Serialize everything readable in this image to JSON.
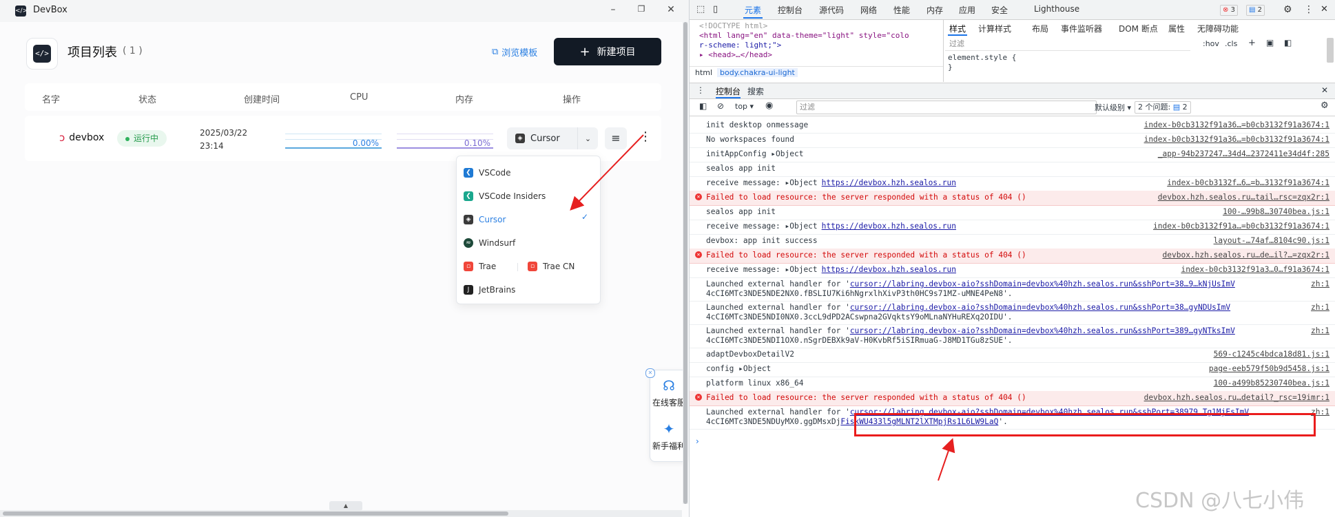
{
  "app": {
    "window_title": "DevBox",
    "logo_glyph": "</>",
    "page_title": "项目列表",
    "count": "( 1 )",
    "browse_label": "浏览模板",
    "new_button_label": "新建项目",
    "columns": [
      "名字",
      "状态",
      "创建时间",
      "CPU",
      "内存",
      "操作"
    ],
    "project": {
      "name": "devbox",
      "status": "运行中",
      "created_date": "2025/03/22",
      "created_time": "23:14",
      "cpu": "0.00%",
      "memory": "0.10%",
      "ide_selected": "Cursor",
      "cpu_fraction": 0.0,
      "memory_fraction": 0.001
    },
    "ide_menu": {
      "items": [
        "VSCode",
        "VSCode Insiders",
        "Cursor",
        "Windsurf",
        "Trae",
        "Trae CN",
        "JetBrains"
      ],
      "selected": "Cursor",
      "check": "✓"
    },
    "float_panel": {
      "support": "在线客服",
      "welfare": "新手福利"
    },
    "icons": [
      "box-icon",
      "plus-icon",
      "template-icon",
      "chevron-down-icon",
      "list-icon",
      "more-vertical-icon",
      "check-icon",
      "headset-icon",
      "sparkle-icon",
      "close-icon"
    ]
  },
  "devtools": {
    "tabs": [
      "元素",
      "控制台",
      "源代码",
      "网络",
      "性能",
      "内存",
      "应用",
      "安全",
      "Lighthouse"
    ],
    "active_tab": "元素",
    "error_count": "3",
    "message_count": "2",
    "elements_lines": [
      "<!DOCTYPE html>",
      "<html lang=\"en\" data-theme=\"light\" style=\"colo",
      "r-scheme: light;\">",
      "▸ <head>…</head>"
    ],
    "breadcrumbs": [
      "html",
      "body.chakra-ui-light"
    ],
    "styles_tabs": [
      "样式",
      "计算样式",
      "布局",
      "事件监听器",
      "DOM 断点",
      "属性",
      "无障碍功能"
    ],
    "styles_filter_placeholder": "过滤",
    "styles_hov": ":hov",
    "styles_cls": ".cls",
    "element_style_1": "element.style {",
    "element_style_2": "}",
    "console_tabs": [
      "控制台",
      "搜索"
    ],
    "context": "top ▾",
    "console_filter_placeholder": "过滤",
    "default_levels": "默认级别 ▾",
    "issues_label": "2 个问题:",
    "issues_count": "2",
    "logs": [
      {
        "type": "log",
        "msg": "init desktop onmessage",
        "src": "index-b0cb3132f91a36…=b0cb3132f91a3674:1"
      },
      {
        "type": "log",
        "msg": "No workspaces found",
        "src": "index-b0cb3132f91a36…=b0cb3132f91a3674:1"
      },
      {
        "type": "log",
        "msg": "initAppConfig ▸Object",
        "src": "_app-94b237247…34d4…2372411e34d4f:285"
      },
      {
        "type": "log",
        "msg": "sealos app init",
        "src": ""
      },
      {
        "type": "log",
        "msg": "receive message: ▸Object",
        "link": "https://devbox.hzh.sealos.run",
        "src": "index-b0cb3132f…6…=b…3132f91a3674:1"
      },
      {
        "type": "error",
        "msg": "Failed to load resource: the server responded with a status of 404 ()",
        "src": "devbox.hzh.sealos.ru…tail…rsc=zqx2r:1"
      },
      {
        "type": "log",
        "msg": "sealos app init",
        "src": "100-…99b8…30740bea.js:1"
      },
      {
        "type": "log",
        "msg": "receive message: ▸Object",
        "link": "https://devbox.hzh.sealos.run",
        "src": "index-b0cb3132f91a…=b0cb3132f91a3674:1"
      },
      {
        "type": "log",
        "msg": "devbox: app init success",
        "src": "layout-…74af…8104c90.js:1"
      },
      {
        "type": "error",
        "msg": "Failed to load resource: the server responded with a status of 404 ()",
        "src": "devbox.hzh.sealos.ru…de…il?…=zqx2r:1"
      },
      {
        "type": "log",
        "msg": "receive message: ▸Object",
        "link": "https://devbox.hzh.sealos.run",
        "src": "index-b0cb3132f91a3…0…f91a3674:1"
      },
      {
        "type": "log2",
        "msg": "Launched external handler for '",
        "link": "cursor://labring.devbox-aio?sshDomain=devbox%40hzh.sealos.run&sshPort=38…9…kNjUsImV",
        "line2": "4cCI6MTc3NDE5NDE2NX0.fBSLIU7Ki6hNgrxlhXivP3th0HC9s71MZ-uMNE4PeN8'.",
        "src": "zh:1"
      },
      {
        "type": "log2",
        "msg": "Launched external handler for '",
        "link": "cursor://labring.devbox-aio?sshDomain=devbox%40hzh.sealos.run&sshPort=38…gyNDUsImV",
        "line2": "4cCI6MTc3NDE5NDI0NX0.3ccL9dPD2ACswpna2GVqktsY9oMLnaNYHuREXq2OIDU'.",
        "src": "zh:1"
      },
      {
        "type": "log2",
        "msg": "Launched external handler for '",
        "link": "cursor://labring.devbox-aio?sshDomain=devbox%40hzh.sealos.run&sshPort=389…gyNTksImV",
        "line2": "4cCI6MTc3NDE5NDI1OX0.nSgrDEBXk9aV-H0KvbRf5iSIRmuaG-J8MD1TGu8zSUE'.",
        "src": "zh:1"
      },
      {
        "type": "log",
        "msg": "adaptDevboxDetailV2",
        "src": "569-c1245c4bdca18d81.js:1"
      },
      {
        "type": "log",
        "msg": "config ▸Object",
        "src": "page-eeb579f50b9d5458.js:1"
      },
      {
        "type": "log",
        "msg": "platform linux x86_64",
        "src": "100-a499b85230740bea.js:1"
      },
      {
        "type": "error",
        "msg": "Failed to load resource: the server responded with a status of 404 ()",
        "src": "devbox.hzh.sealos.ru…detail?_rsc=19imr:1"
      },
      {
        "type": "log2",
        "msg": "Launched external handler for '",
        "link": "cursor://labring.devbox-aio?sshDomain=devbox%40hzh.sealos.run&sshPort=38979…Tg1MjEsImV",
        "line2": "4cCI6MTc3NDE5NDUyMX0.ggDMsxDj",
        "line2_link": "FiskWU433l5gMLNT2lXTMpjRs1L6LW9LaQ",
        "line2_end": "'.",
        "src": "zh:1"
      }
    ],
    "prompt": "›"
  },
  "watermark": "CSDN @八七小伟",
  "colors": {
    "accent": "#2a7fe2",
    "dark_button": "#121a25",
    "status_green": "#239a4a",
    "error_red": "#d30a0a",
    "highlight_red": "#ea1c1c"
  }
}
